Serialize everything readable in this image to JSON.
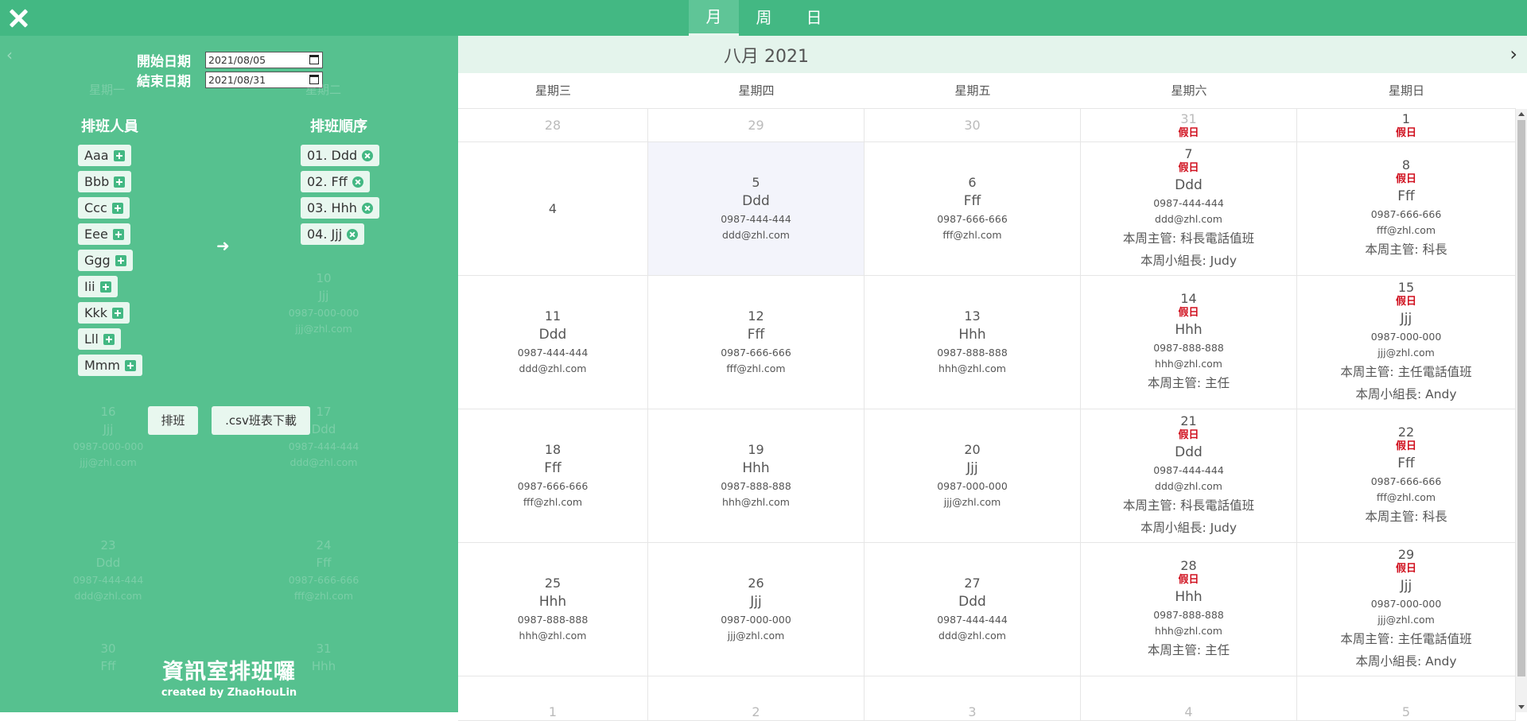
{
  "topbar": {
    "tabs": [
      "月",
      "周",
      "日"
    ],
    "active_tab": "月"
  },
  "side": {
    "start_label": "開始日期",
    "start_value": "2021/08/05",
    "end_label": "結束日期",
    "end_value": "2021/08/31",
    "staff_title": "排班人員",
    "order_title": "排班順序",
    "staff": [
      "Aaa",
      "Bbb",
      "Ccc",
      "Eee",
      "Ggg",
      "Iii",
      "Kkk",
      "Lll",
      "Mmm"
    ],
    "order": [
      "01. Ddd",
      "02. Fff",
      "03. Hhh",
      "04. Jjj"
    ],
    "schedule_btn": "排班",
    "download_btn": ".csv班表下載",
    "app_title": "資訊室排班囉",
    "credit": "created by ZhaoHouLin",
    "ghost_weekdays": [
      "星期一",
      "星期二"
    ],
    "ghost_cells": [
      {
        "day": "10",
        "person": "Jjj",
        "phone": "0987-000-000",
        "email": "jjj@zhl.com"
      },
      {
        "day": "16",
        "person": "Jjj",
        "phone": "0987-000-000",
        "email": "jjj@zhl.com"
      },
      {
        "day": "17",
        "person": "Ddd",
        "phone": "0987-444-444",
        "email": "ddd@zhl.com"
      },
      {
        "day": "23",
        "person": "Ddd",
        "phone": "0987-444-444",
        "email": "ddd@zhl.com"
      },
      {
        "day": "24",
        "person": "Fff",
        "phone": "0987-666-666",
        "email": "fff@zhl.com"
      },
      {
        "day": "30",
        "person": "Fff"
      },
      {
        "day": "31",
        "person": "Hhh"
      }
    ]
  },
  "calendar": {
    "month_title": "八月 2021",
    "next_icon": "chevron-right-icon",
    "prev_icon": "chevron-left-icon",
    "weekdays": [
      "星期三",
      "星期四",
      "星期五",
      "星期六",
      "星期日"
    ],
    "holiday_label": "假日",
    "rows": [
      [
        {
          "day": "28",
          "dim": true
        },
        {
          "day": "29",
          "dim": true
        },
        {
          "day": "30",
          "dim": true
        },
        {
          "day": "31",
          "dim": true,
          "holiday": true
        },
        {
          "day": "1",
          "holiday": true
        }
      ],
      [
        {
          "day": "4"
        },
        {
          "day": "5",
          "person": "Ddd",
          "phone": "0987-444-444",
          "email": "ddd@zhl.com",
          "selected": true
        },
        {
          "day": "6",
          "person": "Fff",
          "phone": "0987-666-666",
          "email": "fff@zhl.com"
        },
        {
          "day": "7",
          "holiday": true,
          "person": "Ddd",
          "phone": "0987-444-444",
          "email": "ddd@zhl.com",
          "roles": [
            "本周主管: 科長電話值班",
            "本周小組長: Judy"
          ]
        },
        {
          "day": "8",
          "holiday": true,
          "person": "Fff",
          "phone": "0987-666-666",
          "email": "fff@zhl.com",
          "roles": [
            "本周主管: 科長"
          ]
        }
      ],
      [
        {
          "day": "11",
          "person": "Ddd",
          "phone": "0987-444-444",
          "email": "ddd@zhl.com"
        },
        {
          "day": "12",
          "person": "Fff",
          "phone": "0987-666-666",
          "email": "fff@zhl.com"
        },
        {
          "day": "13",
          "person": "Hhh",
          "phone": "0987-888-888",
          "email": "hhh@zhl.com"
        },
        {
          "day": "14",
          "holiday": true,
          "person": "Hhh",
          "phone": "0987-888-888",
          "email": "hhh@zhl.com",
          "roles": [
            "本周主管: 主任"
          ]
        },
        {
          "day": "15",
          "holiday": true,
          "person": "Jjj",
          "phone": "0987-000-000",
          "email": "jjj@zhl.com",
          "roles": [
            "本周主管: 主任電話值班",
            "本周小組長: Andy"
          ]
        }
      ],
      [
        {
          "day": "18",
          "person": "Fff",
          "phone": "0987-666-666",
          "email": "fff@zhl.com"
        },
        {
          "day": "19",
          "person": "Hhh",
          "phone": "0987-888-888",
          "email": "hhh@zhl.com"
        },
        {
          "day": "20",
          "person": "Jjj",
          "phone": "0987-000-000",
          "email": "jjj@zhl.com"
        },
        {
          "day": "21",
          "holiday": true,
          "person": "Ddd",
          "phone": "0987-444-444",
          "email": "ddd@zhl.com",
          "roles": [
            "本周主管: 科長電話值班",
            "本周小組長: Judy"
          ]
        },
        {
          "day": "22",
          "holiday": true,
          "person": "Fff",
          "phone": "0987-666-666",
          "email": "fff@zhl.com",
          "roles": [
            "本周主管: 科長"
          ]
        }
      ],
      [
        {
          "day": "25",
          "person": "Hhh",
          "phone": "0987-888-888",
          "email": "hhh@zhl.com"
        },
        {
          "day": "26",
          "person": "Jjj",
          "phone": "0987-000-000",
          "email": "jjj@zhl.com"
        },
        {
          "day": "27",
          "person": "Ddd",
          "phone": "0987-444-444",
          "email": "ddd@zhl.com"
        },
        {
          "day": "28",
          "holiday": true,
          "person": "Hhh",
          "phone": "0987-888-888",
          "email": "hhh@zhl.com",
          "roles": [
            "本周主管: 主任"
          ]
        },
        {
          "day": "29",
          "holiday": true,
          "person": "Jjj",
          "phone": "0987-000-000",
          "email": "jjj@zhl.com",
          "roles": [
            "本周主管: 主任電話值班",
            "本周小組長: Andy"
          ]
        }
      ],
      [
        {
          "day": "1",
          "dim": true
        },
        {
          "day": "2",
          "dim": true
        },
        {
          "day": "3",
          "dim": true
        },
        {
          "day": "4",
          "dim": true
        },
        {
          "day": "5",
          "dim": true
        }
      ]
    ]
  }
}
